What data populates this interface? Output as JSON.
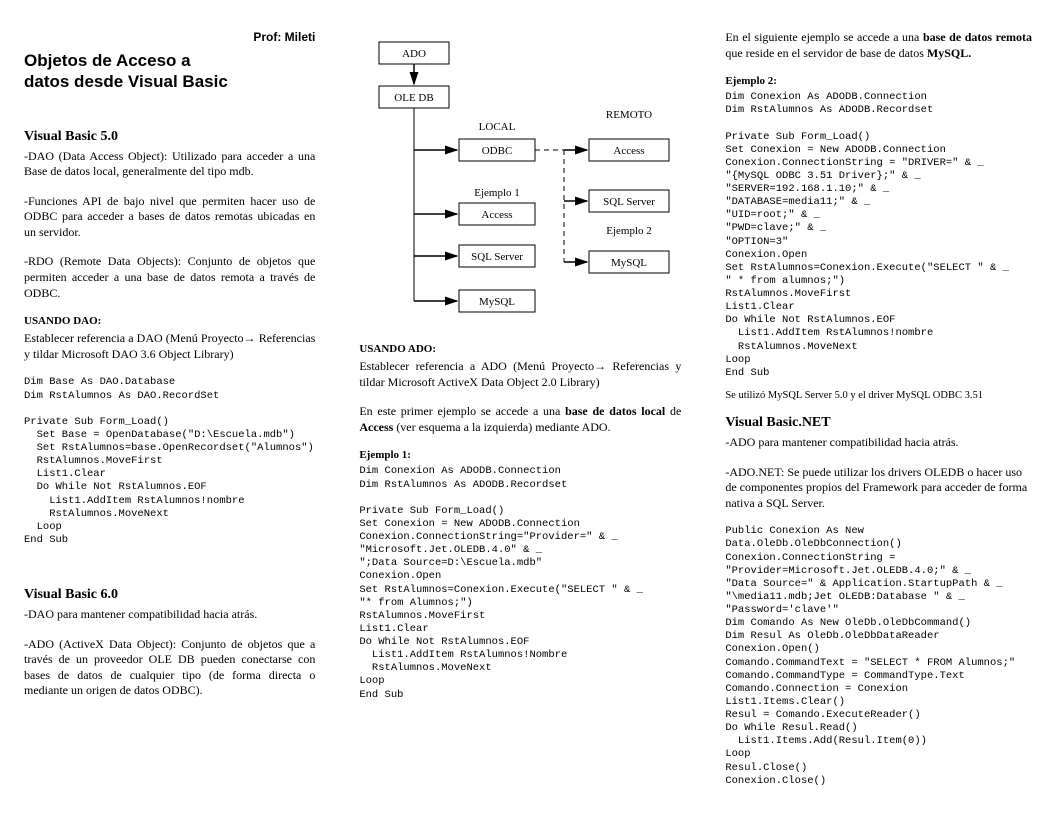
{
  "meta": {
    "professor": "Prof: Mileti"
  },
  "title": "Objetos de Acceso a\ndatos desde Visual Basic",
  "col1": {
    "h_vb5": "Visual Basic 5.0",
    "p_dao": "-DAO (Data Access Object): Utilizado para acceder a una Base de datos local, generalmente del tipo mdb.",
    "p_api": "-Funciones API de bajo nivel que permiten hacer uso de ODBC para acceder a bases de datos remotas ubicadas en un servidor.",
    "p_rdo": "-RDO (Remote Data Objects): Conjunto de objetos que permiten acceder a una base de datos remota a través de ODBC.",
    "h_usandodao": "USANDO DAO:",
    "p_usandodao": "Establecer referencia a DAO (Menú Proyecto→ Referencias y tildar Microsoft DAO 3.6 Object Library)",
    "code_dao": "Dim Base As DAO.Database\nDim RstAlumnos As DAO.RecordSet\n\nPrivate Sub Form_Load()\n  Set Base = OpenDatabase(\"D:\\Escuela.mdb\")\n  Set RstAlumnos=base.OpenRecordset(\"Alumnos\")\n  RstAlumnos.MoveFirst\n  List1.Clear\n  Do While Not RstAlumnos.EOF\n    List1.AddItem RstAlumnos!nombre\n    RstAlumnos.MoveNext\n  Loop\nEnd Sub",
    "h_vb6": "Visual Basic 6.0",
    "p_vb6a": "-DAO para mantener compatibilidad hacia atrás.",
    "p_vb6b": "-ADO (ActiveX Data Object): Conjunto de objetos que a través de un proveedor OLE DB pueden conectarse con bases de datos de cualquier tipo  (de forma directa o mediante un origen de datos ODBC)."
  },
  "diagram": {
    "ado": "ADO",
    "oledb": "OLE DB",
    "local": "LOCAL",
    "remoto": "REMOTO",
    "odbc": "ODBC",
    "access_l": "Access",
    "sqlserver_l": "SQL Server",
    "mysql_l": "MySQL",
    "access_r": "Access",
    "sqlserver_r": "SQL Server",
    "mysql_r": "MySQL",
    "ej1": "Ejemplo 1",
    "ej2": "Ejemplo 2"
  },
  "col2": {
    "h_usandoado": "USANDO ADO:",
    "p_usandoado": "Establecer referencia a ADO (Menú Proyecto→ Referencias y tildar Microsoft ActiveX Data Object 2.0 Library)",
    "p_ej1intro_a": "En este primer ejemplo se accede a una ",
    "p_ej1intro_b": "base de datos local",
    "p_ej1intro_c": " de ",
    "p_ej1intro_d": "Access",
    "p_ej1intro_e": " (ver esquema a la izquierda) mediante ADO.",
    "h_ej1": "Ejemplo 1:",
    "code_ej1": "Dim Conexion As ADODB.Connection\nDim RstAlumnos As ADODB.Recordset\n\nPrivate Sub Form_Load()\nSet Conexion = New ADODB.Connection\nConexion.ConnectionString=\"Provider=\" & _\n\"Microsoft.Jet.OLEDB.4.0\" & _\n\";Data Source=D:\\Escuela.mdb\"\nConexion.Open\nSet RstAlumnos=Conexion.Execute(\"SELECT \" & _\n\"* from Alumnos;\")\nRstAlumnos.MoveFirst\nList1.Clear\nDo While Not RstAlumnos.EOF\n  List1.AddItem RstAlumnos!Nombre\n  RstAlumnos.MoveNext\nLoop\nEnd Sub"
  },
  "col3": {
    "p_intro_a": "En el siguiente ejemplo se accede a una ",
    "p_intro_b": "base de datos remota",
    "p_intro_c": " que reside en el servidor de base de datos ",
    "p_intro_d": "MySQL.",
    "h_ej2": "Ejemplo 2:",
    "code_ej2": "Dim Conexion As ADODB.Connection\nDim RstAlumnos As ADODB.Recordset\n\nPrivate Sub Form_Load()\nSet Conexion = New ADODB.Connection\nConexion.ConnectionString = \"DRIVER=\" & _\n\"{MySQL ODBC 3.51 Driver};\" & _\n\"SERVER=192.168.1.10;\" & _\n\"DATABASE=media11;\" & _\n\"UID=root;\" & _\n\"PWD=clave;\" & _\n\"OPTION=3\"\nConexion.Open\nSet RstAlumnos=Conexion.Execute(\"SELECT \" & _\n\" * from alumnos;\")\nRstAlumnos.MoveFirst\nList1.Clear\nDo While Not RstAlumnos.EOF\n  List1.AddItem RstAlumnos!nombre\n  RstAlumnos.MoveNext\nLoop\nEnd Sub",
    "note_mysql": "Se utilizó MySQL Server 5.0 y el driver MySQL ODBC 3.51",
    "h_vbnet": "Visual Basic.NET",
    "p_vbnet_a": "-ADO para mantener compatibilidad hacia atrás.",
    "p_vbnet_b": "-ADO.NET: Se puede utilizar los drivers OLEDB o hacer uso de componentes propios del Framework para acceder de forma nativa a SQL Server.",
    "code_vbnet": "Public Conexion As New\nData.OleDb.OleDbConnection()\nConexion.ConnectionString =\n\"Provider=Microsoft.Jet.OLEDB.4.0;\" & _\n\"Data Source=\" & Application.StartupPath & _\n\"\\media11.mdb;Jet OLEDB:Database \" & _\n\"Password='clave'\"\nDim Comando As New OleDb.OleDbCommand()\nDim Resul As OleDb.OleDbDataReader\nConexion.Open()\nComando.CommandText = \"SELECT * FROM Alumnos;\"\nComando.CommandType = CommandType.Text\nComando.Connection = Conexion\nList1.Items.Clear()\nResul = Comando.ExecuteReader()\nDo While Resul.Read()\n  List1.Items.Add(Resul.Item(0))\nLoop\nResul.Close()\nConexion.Close()"
  }
}
